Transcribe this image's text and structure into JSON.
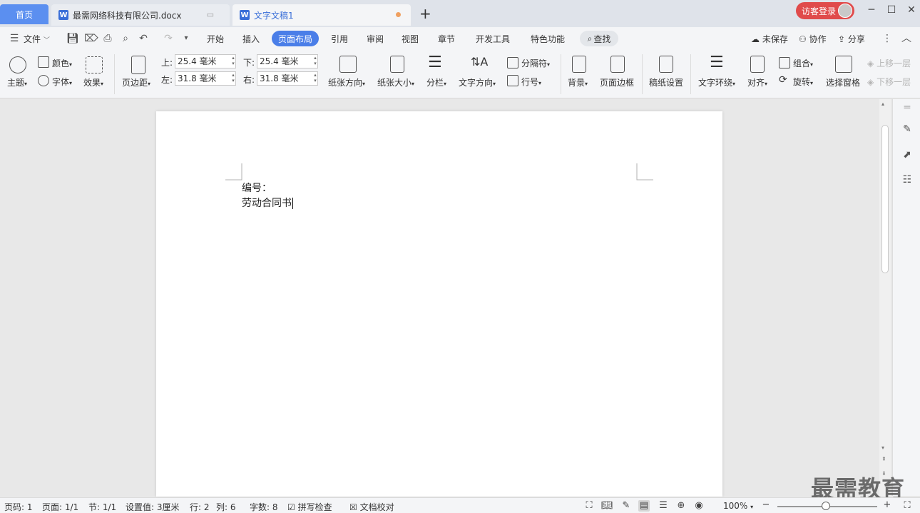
{
  "tabs": {
    "home": "首页",
    "doc1": "最需网络科技有限公司.docx",
    "doc2": "文字文稿1",
    "login": "访客登录"
  },
  "menu": {
    "file": "文件",
    "items": [
      "开始",
      "插入",
      "页面布局",
      "引用",
      "审阅",
      "视图",
      "章节",
      "开发工具",
      "特色功能"
    ],
    "search": "查找",
    "unsaved": "未保存",
    "collab": "协作",
    "share": "分享"
  },
  "ribbon": {
    "theme": "主题",
    "color": "颜色",
    "font": "字体",
    "effect": "效果",
    "margins": "页边距",
    "top_label": "上:",
    "top_value": "25.4 毫米",
    "bottom_label": "下:",
    "bottom_value": "25.4 毫米",
    "left_label": "左:",
    "left_value": "31.8 毫米",
    "right_label": "右:",
    "right_value": "31.8 毫米",
    "orientation": "纸张方向",
    "size": "纸张大小",
    "columns": "分栏",
    "text_direction": "文字方向",
    "breaks": "分隔符",
    "line_numbers": "行号",
    "background": "背景",
    "page_border": "页面边框",
    "manuscript": "稿纸设置",
    "wrap": "文字环绕",
    "align": "对齐",
    "group": "组合",
    "rotate": "旋转",
    "selection_pane": "选择窗格",
    "bring_forward": "上移一层",
    "send_backward": "下移一层"
  },
  "document": {
    "line1": "编号：",
    "line2": "劳动合同书"
  },
  "watermark": "最需教育",
  "status": {
    "page_code": "页码: 1",
    "pages": "页面: 1/1",
    "section": "节: 1/1",
    "setting": "设置值: 3厘米",
    "row": "行: 2",
    "col": "列: 6",
    "words": "字数: 8",
    "spell": "拼写检查",
    "proof": "文档校对",
    "zoom": "100%"
  },
  "colors": {
    "accent": "#4a7ee8",
    "login": "#e04b4b"
  }
}
